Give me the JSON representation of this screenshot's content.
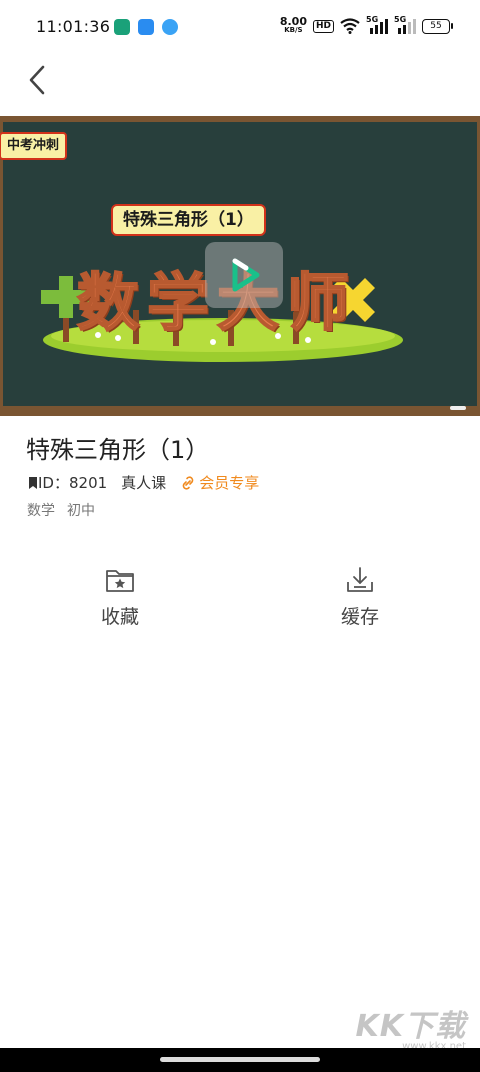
{
  "status_bar": {
    "time": "11:01:36",
    "speed_value": "8.00",
    "speed_unit": "KB/S",
    "hd_label": "HD",
    "signal1": "5G",
    "signal2": "5G",
    "battery": "55"
  },
  "video": {
    "corner_tag": "中考冲刺",
    "lesson_badge": "特殊三角形（1）",
    "logo_text": "数学大师"
  },
  "course": {
    "title": "特殊三角形（1）",
    "id_label": "ID：",
    "id_value": "8201",
    "course_type": "真人课",
    "vip_label": "会员专享",
    "tags": [
      "数学",
      "初中"
    ]
  },
  "actions": {
    "favorite_label": "收藏",
    "download_label": "缓存"
  },
  "watermark": {
    "brand": "KK下载",
    "url": "www.kkx.net"
  },
  "colors": {
    "vip_orange": "#f08a1e",
    "board_green": "#283f3c",
    "frame_brown": "#7a5532",
    "play_green": "#19c08a"
  }
}
